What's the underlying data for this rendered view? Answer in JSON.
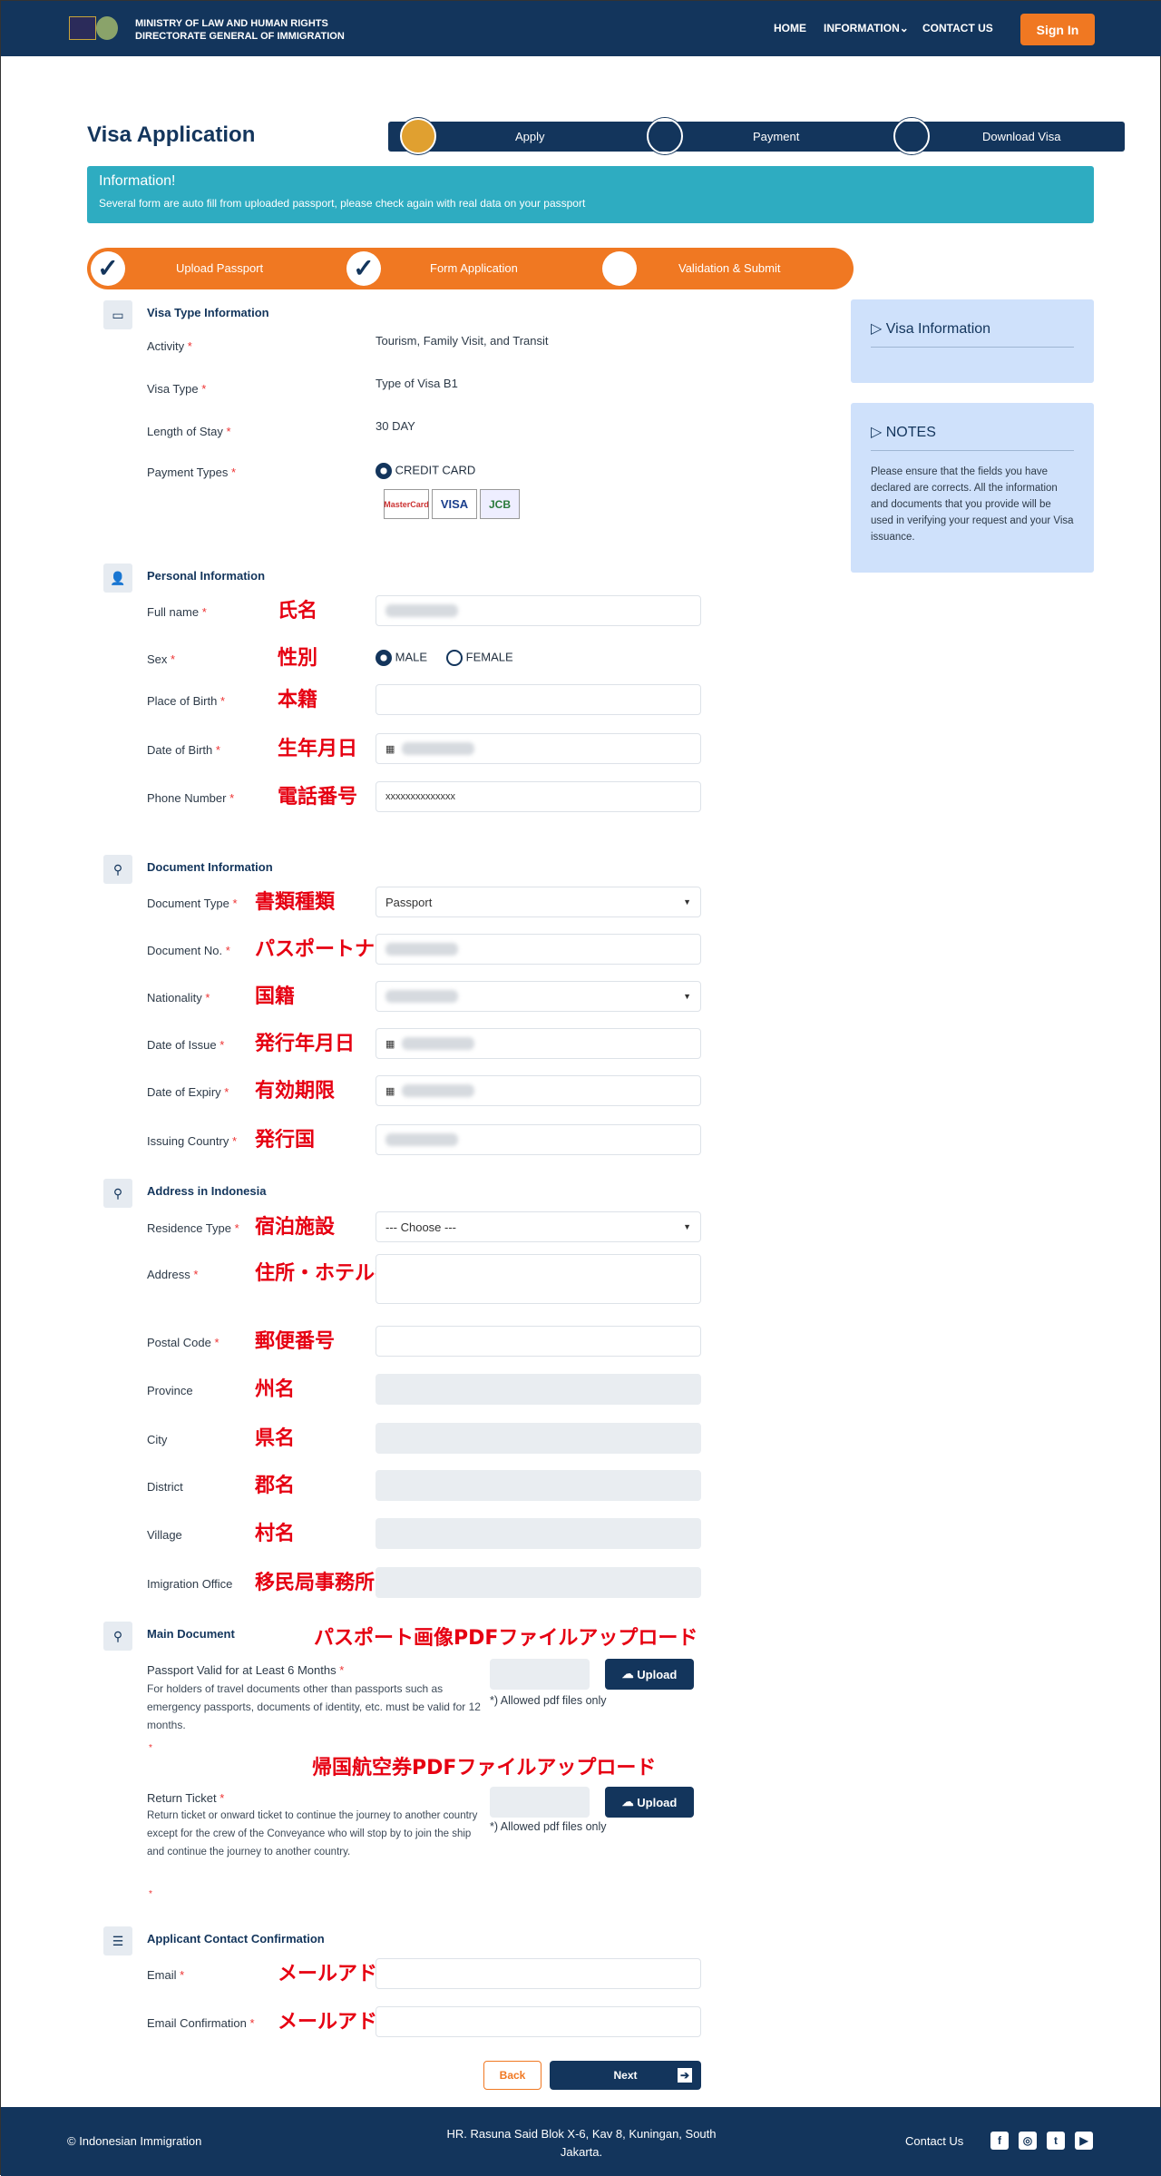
{
  "header": {
    "brand_line1": "MINISTRY OF LAW AND HUMAN RIGHTS",
    "brand_line2": "DIRECTORATE GENERAL OF IMMIGRATION",
    "nav": [
      "HOME",
      "INFORMATION",
      "CONTACT US"
    ],
    "sign_in": "Sign In"
  },
  "page": {
    "title": "Visa Application",
    "steps": [
      "Apply",
      "Payment",
      "Download Visa"
    ],
    "active_step": 0
  },
  "info": {
    "title": "Information!",
    "text": "Several form are auto fill from uploaded passport, please check again with real data on your passport"
  },
  "progress": {
    "steps": [
      "Upload Passport",
      "Form Application",
      "Validation & Submit"
    ],
    "completed": 2
  },
  "colors": {
    "navy": "#13355c",
    "orange": "#f07822",
    "teal": "#2eacc1",
    "annotation": "#e60012"
  },
  "visa_type": {
    "title": "Visa Type Information",
    "rows": [
      {
        "label": "Activity",
        "value": "Tourism, Family Visit, and Transit"
      },
      {
        "label": "Visa Type",
        "value": "Type of Visa B1"
      },
      {
        "label": "Length of Stay",
        "value": "30 DAY"
      },
      {
        "label": "Payment Types",
        "value": "CREDIT CARD"
      }
    ],
    "cards": [
      "MasterCard",
      "VISA",
      "JCB"
    ]
  },
  "personal": {
    "title": "Personal Information",
    "fields": [
      {
        "label": "Full name",
        "type": "blur",
        "annotation": "氏名"
      },
      {
        "label": "Sex",
        "type": "radio",
        "options": [
          "MALE",
          "FEMALE"
        ],
        "selected": "MALE",
        "annotation": "性別"
      },
      {
        "label": "Place of Birth",
        "type": "text",
        "value": "",
        "annotation": "本籍"
      },
      {
        "label": "Date of Birth",
        "type": "date",
        "annotation": "生年月日"
      },
      {
        "label": "Phone Number",
        "type": "text",
        "value": "xxxxxxxxxxxxxx",
        "annotation": "電話番号"
      }
    ]
  },
  "document": {
    "title": "Document Information",
    "fields": [
      {
        "label": "Document Type",
        "type": "select",
        "value": "Passport",
        "annotation": "書類種類"
      },
      {
        "label": "Document No.",
        "type": "blur",
        "annotation": "パスポートナンバー"
      },
      {
        "label": "Nationality",
        "type": "selectblur",
        "annotation": "国籍"
      },
      {
        "label": "Date of Issue",
        "type": "date",
        "annotation": "発行年月日"
      },
      {
        "label": "Date of Expiry",
        "type": "date",
        "annotation": "有効期限"
      },
      {
        "label": "Issuing Country",
        "type": "blur",
        "annotation": "発行国"
      }
    ]
  },
  "address": {
    "title": "Address in Indonesia",
    "fields": [
      {
        "label": "Residence Type",
        "type": "select",
        "value": "--- Choose ---",
        "annotation": "宿泊施設"
      },
      {
        "label": "Address",
        "type": "textarea",
        "annotation": "住所・ホテル名"
      },
      {
        "label": "Postal Code",
        "type": "text",
        "value": "",
        "annotation": "郵便番号"
      },
      {
        "label": "Province",
        "type": "disabled",
        "required": false,
        "annotation": "州名"
      },
      {
        "label": "City",
        "type": "disabled",
        "required": false,
        "annotation": "県名"
      },
      {
        "label": "District",
        "type": "disabled",
        "required": false,
        "annotation": "郡名"
      },
      {
        "label": "Village",
        "type": "disabled",
        "required": false,
        "annotation": "村名"
      },
      {
        "label": "Imigration Office",
        "type": "disabled",
        "required": false,
        "annotation": "移民局事務所"
      }
    ]
  },
  "main_document": {
    "title": "Main Document",
    "passport": {
      "label": "Passport Valid for at Least 6 Months",
      "desc": "For holders of travel documents other than passports such as emergency passports, documents of identity, etc. must be valid for 12 months.",
      "upload": "Upload",
      "note": "*) Allowed pdf files only",
      "annotation": "パスポート画像PDFファイルアップロード"
    },
    "ticket": {
      "label": "Return Ticket",
      "desc": "Return ticket or onward ticket to continue the journey to another country except for the crew of the Conveyance who will stop by to join the ship and continue the journey to another country.",
      "upload": "Upload",
      "note": "*) Allowed pdf files only",
      "annotation": "帰国航空券PDFファイルアップロード"
    }
  },
  "contact": {
    "title": "Applicant Contact Confirmation",
    "fields": [
      {
        "label": "Email",
        "type": "text",
        "value": "",
        "annotation": "メールアドレス"
      },
      {
        "label": "Email Confirmation",
        "type": "text",
        "value": "",
        "annotation": "メールアドレス"
      }
    ]
  },
  "buttons": {
    "back": "Back",
    "next": "Next"
  },
  "sidebar": {
    "visa_info": "Visa Information",
    "notes_title": "NOTES",
    "notes": "Please ensure that the fields you have declared are corrects. All the information and documents that you provide will be used in verifying your request and your Visa issuance."
  },
  "footer": {
    "copyright": "© Indonesian Immigration",
    "address": "HR. Rasuna Said Blok X-6, Kav 8, Kuningan, South Jakarta.",
    "contact": "Contact Us",
    "social": [
      "facebook",
      "instagram",
      "twitter",
      "youtube"
    ]
  }
}
